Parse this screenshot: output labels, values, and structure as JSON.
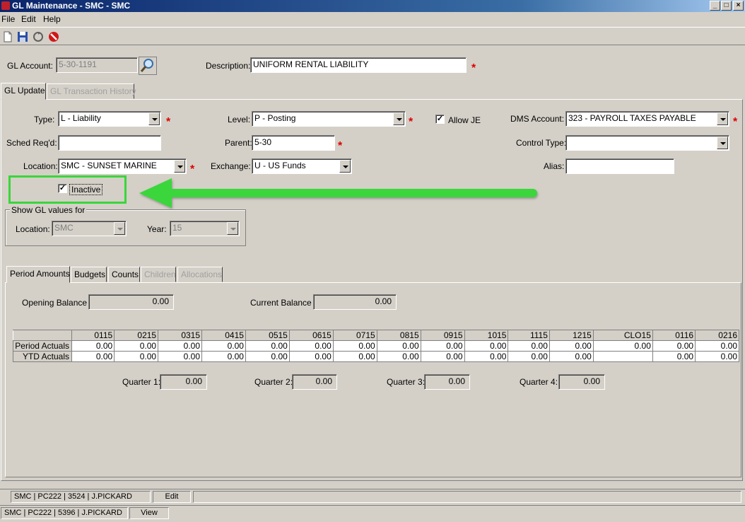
{
  "window": {
    "title": "GL Maintenance - SMC - SMC",
    "controls": [
      "_",
      "□",
      "×"
    ]
  },
  "menu": [
    "File",
    "Edit",
    "Help"
  ],
  "header": {
    "gl_account_label": "GL Account:",
    "gl_account_value": "5-30-1191",
    "description_label": "Description:",
    "description_value": "UNIFORM RENTAL LIABILITY"
  },
  "top_tabs": [
    "GL Update",
    "GL Transaction History"
  ],
  "form": {
    "type_label": "Type:",
    "type_value": "L - Liability",
    "level_label": "Level:",
    "level_value": "P - Posting",
    "allow_je_label": "Allow JE",
    "allow_je_checked": "✓",
    "dms_account_label": "DMS Account:",
    "dms_account_value": "323 - PAYROLL TAXES PAYABLE",
    "sched_label": "Sched Req'd:",
    "sched_value": "",
    "parent_label": "Parent:",
    "parent_value": "5-30",
    "control_type_label": "Control Type:",
    "control_type_value": "",
    "location_label": "Location:",
    "location_value": "SMC - SUNSET MARINE",
    "exchange_label": "Exchange:",
    "exchange_value": "U - US Funds",
    "alias_label": "Alias:",
    "alias_value": "",
    "inactive_label": "Inactive",
    "inactive_checked": "✓"
  },
  "show_gl": {
    "legend": "Show GL values for",
    "location_label": "Location:",
    "location_value": "SMC",
    "year_label": "Year:",
    "year_value": "15"
  },
  "bottom_tabs": [
    "Period Amounts",
    "Budgets",
    "Counts",
    "Children",
    "Allocations"
  ],
  "balances": {
    "opening_label": "Opening Balance",
    "opening_value": "0.00",
    "current_label": "Current Balance",
    "current_value": "0.00"
  },
  "period_grid": {
    "columns": [
      "0115",
      "0215",
      "0315",
      "0415",
      "0515",
      "0615",
      "0715",
      "0815",
      "0915",
      "1015",
      "1115",
      "1215",
      "CLO15",
      "0116",
      "0216"
    ],
    "rows": [
      {
        "label": "Period Actuals",
        "values": [
          "0.00",
          "0.00",
          "0.00",
          "0.00",
          "0.00",
          "0.00",
          "0.00",
          "0.00",
          "0.00",
          "0.00",
          "0.00",
          "0.00",
          "0.00",
          "0.00",
          "0.00"
        ]
      },
      {
        "label": "YTD Actuals",
        "values": [
          "0.00",
          "0.00",
          "0.00",
          "0.00",
          "0.00",
          "0.00",
          "0.00",
          "0.00",
          "0.00",
          "0.00",
          "0.00",
          "0.00",
          "",
          "0.00",
          "0.00"
        ]
      }
    ]
  },
  "quarters": [
    {
      "label": "Quarter 1:",
      "value": "0.00"
    },
    {
      "label": "Quarter 2:",
      "value": "0.00"
    },
    {
      "label": "Quarter 3:",
      "value": "0.00"
    },
    {
      "label": "Quarter 4:",
      "value": "0.00"
    }
  ],
  "status1": {
    "session": "SMC | PC222 | 3524 | J.PICKARD",
    "mode": "Edit"
  },
  "status2": {
    "session": "SMC | PC222 | 5396 | J.PICKARD",
    "mode": "View"
  },
  "colors": {
    "highlight": "#3ad63a",
    "required": "#e00000",
    "title_bar": "#0a246a"
  },
  "icons": [
    "new-document-icon",
    "save-icon",
    "refresh-icon",
    "cancel-icon",
    "search-magnifier-icon"
  ]
}
